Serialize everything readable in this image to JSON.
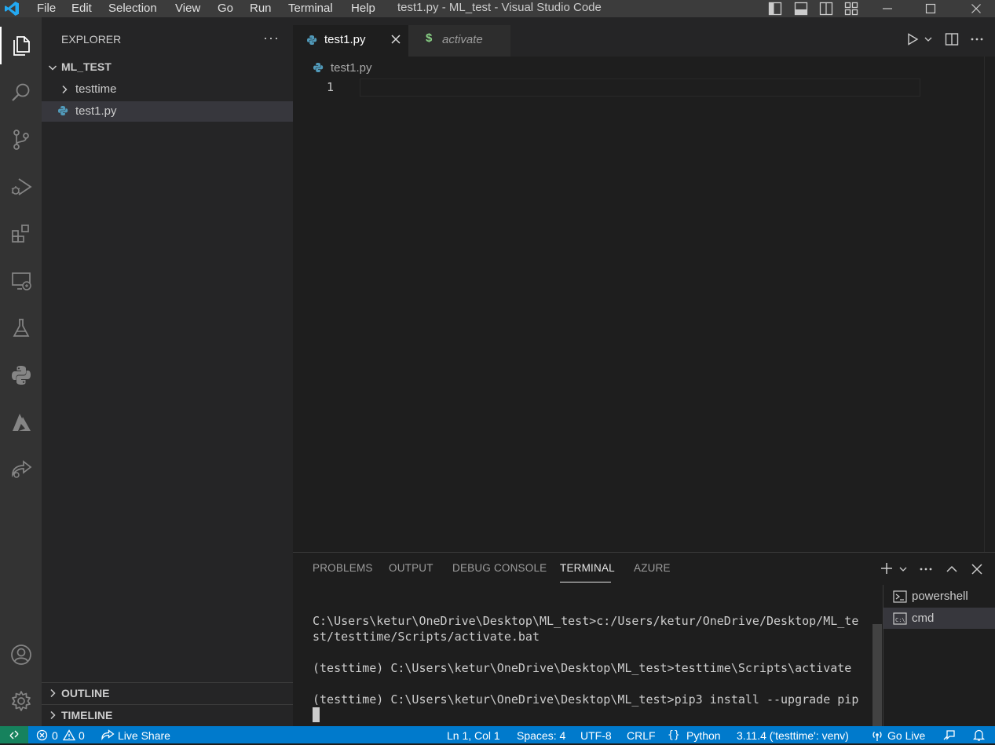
{
  "window": {
    "title": "test1.py - ML_test - Visual Studio Code",
    "menu": [
      "File",
      "Edit",
      "Selection",
      "View",
      "Go",
      "Run",
      "Terminal",
      "Help"
    ]
  },
  "sidebar": {
    "title": "EXPLORER",
    "more": "···",
    "folder": "ML_TEST",
    "items": [
      {
        "label": "testtime",
        "type": "folder"
      },
      {
        "label": "test1.py",
        "type": "file"
      }
    ],
    "outline": "OUTLINE",
    "timeline": "TIMELINE"
  },
  "tabs": [
    {
      "label": "test1.py",
      "active": true
    },
    {
      "label": "activate",
      "active": false,
      "icon_glyph": "$"
    }
  ],
  "editor": {
    "breadcrumb": "test1.py",
    "line_number": "1"
  },
  "panel": {
    "tabs": [
      "PROBLEMS",
      "OUTPUT",
      "DEBUG CONSOLE",
      "TERMINAL",
      "AZURE"
    ],
    "active_tab": "TERMINAL",
    "terminal_lines": [
      "C:\\Users\\ketur\\OneDrive\\Desktop\\ML_test>c:/Users/ketur/OneDrive/Desktop/ML_te",
      "st/testtime/Scripts/activate.bat",
      "",
      "(testtime) C:\\Users\\ketur\\OneDrive\\Desktop\\ML_test>testtime\\Scripts\\activate",
      "",
      "(testtime) C:\\Users\\ketur\\OneDrive\\Desktop\\ML_test>pip3 install --upgrade pip"
    ],
    "terminals": [
      {
        "label": "powershell",
        "icon": "terminal-powershell-icon"
      },
      {
        "label": "cmd",
        "icon": "terminal-cmd-icon"
      }
    ]
  },
  "statusbar": {
    "errors": "0",
    "warnings": "0",
    "live_share": "Live Share",
    "position": "Ln 1, Col 1",
    "spaces": "Spaces: 4",
    "encoding": "UTF-8",
    "eol": "CRLF",
    "language": "Python",
    "interpreter": "3.11.4 ('testtime': venv)",
    "go_live": "Go Live"
  },
  "colors": {
    "accent": "#007acc",
    "python_icon": "#519aba",
    "shell_icon": "#89d185"
  }
}
